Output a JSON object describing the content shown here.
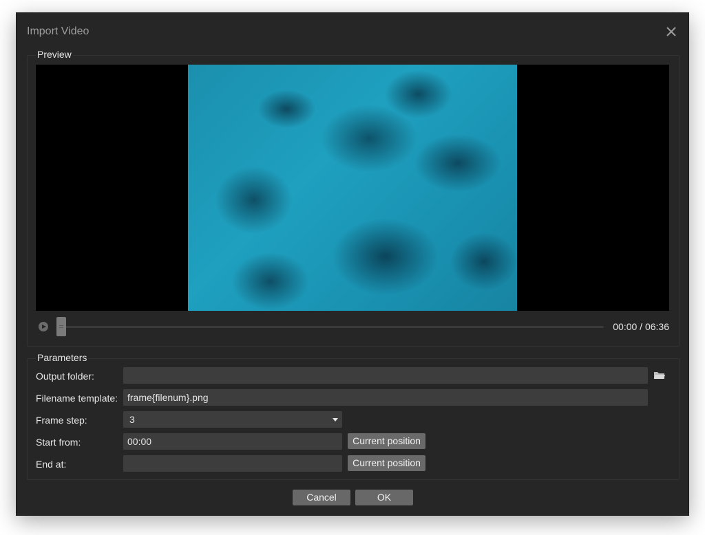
{
  "dialog": {
    "title": "Import Video",
    "close_icon": "close-icon"
  },
  "preview": {
    "group_label": "Preview",
    "play_icon": "play-icon",
    "time_display": "00:00 / 06:36",
    "seek_position_fraction": 0.0
  },
  "parameters": {
    "group_label": "Parameters",
    "output_folder": {
      "label": "Output folder:",
      "value": "",
      "icon": "folder-icon"
    },
    "filename_template": {
      "label": "Filename template:",
      "value": "frame{filenum}.png"
    },
    "frame_step": {
      "label": "Frame step:",
      "value": "3"
    },
    "start_from": {
      "label": "Start from:",
      "value": "00:00",
      "button_label": "Current position"
    },
    "end_at": {
      "label": "End at:",
      "value": "",
      "button_label": "Current position"
    }
  },
  "footer": {
    "cancel_label": "Cancel",
    "ok_label": "OK"
  }
}
